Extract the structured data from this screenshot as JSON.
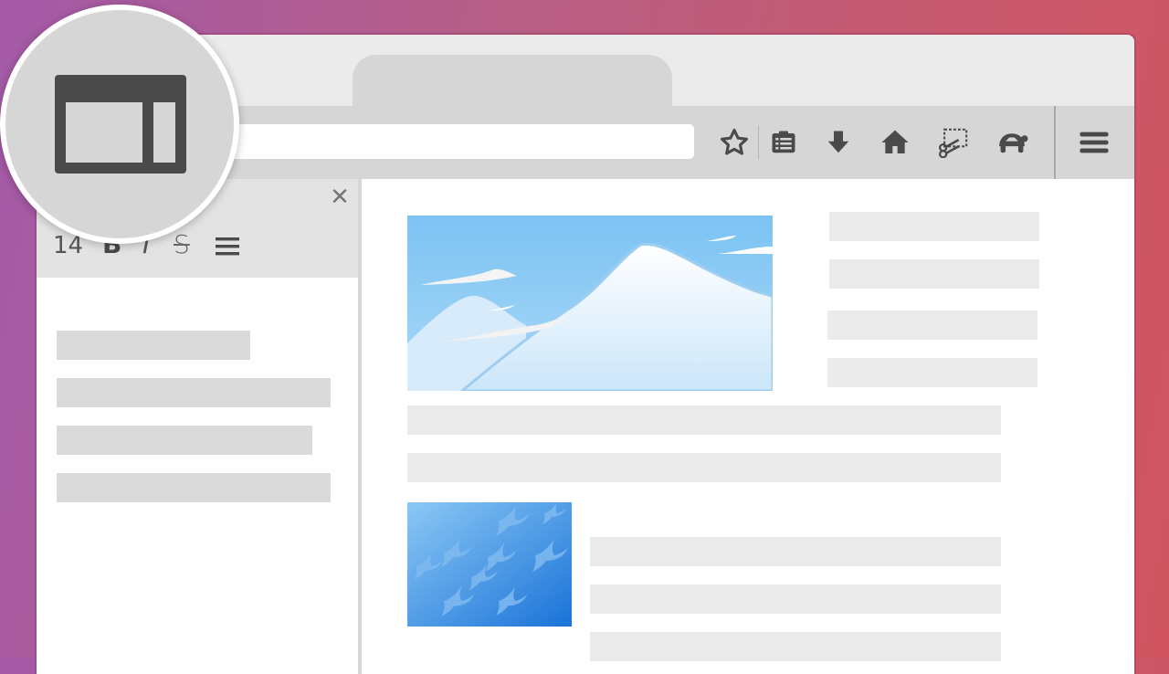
{
  "window": {
    "tab": {
      "active": true
    },
    "url_bar": {
      "value": ""
    },
    "toolbar": {
      "buttons": [
        "bookmark-star-icon",
        "reader-list-icon",
        "download-icon",
        "home-icon",
        "screenshot-scissors-icon",
        "turtle-icon"
      ],
      "menu": "hamburger-menu-icon"
    }
  },
  "sidebar": {
    "close_glyph": "✕",
    "format_toolbar": {
      "font_size": "14",
      "bold": "B",
      "italic": "I",
      "strike": "S",
      "list_icon": "list-icon"
    }
  },
  "feature_badge": {
    "icon": "sidebar-layout-icon"
  },
  "colors": {
    "background_from": "#a45aa8",
    "background_to": "#d05560",
    "chrome": "#d6d6d6",
    "skeleton_dark": "#dadada",
    "skeleton_light": "#ebebeb",
    "icon": "#4a4a4a"
  }
}
